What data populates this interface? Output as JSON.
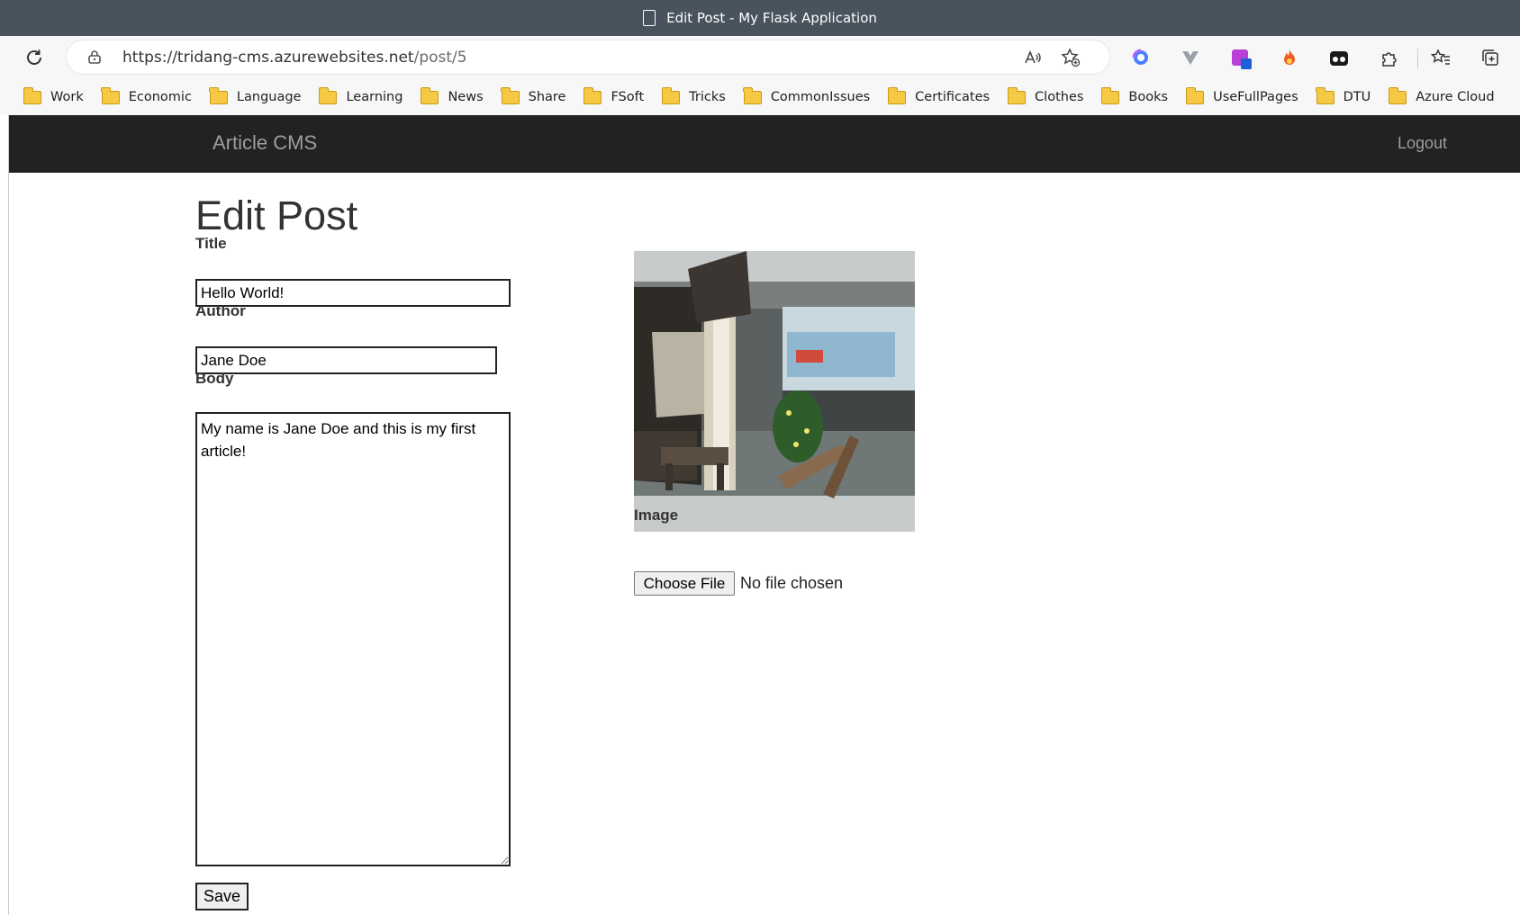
{
  "window": {
    "title": "Edit Post - My Flask Application"
  },
  "address_bar": {
    "url_host": "https://tridang-cms.azurewebsites.net",
    "url_path": "/post/5"
  },
  "bookmarks": [
    {
      "label": "Work"
    },
    {
      "label": "Economic"
    },
    {
      "label": "Language"
    },
    {
      "label": "Learning"
    },
    {
      "label": "News"
    },
    {
      "label": "Share"
    },
    {
      "label": "FSoft"
    },
    {
      "label": "Tricks"
    },
    {
      "label": "CommonIssues"
    },
    {
      "label": "Certificates"
    },
    {
      "label": "Clothes"
    },
    {
      "label": "Books"
    },
    {
      "label": "UseFullPages"
    },
    {
      "label": "DTU"
    },
    {
      "label": "Azure Cloud"
    }
  ],
  "navbar": {
    "brand": "Article CMS",
    "logout": "Logout"
  },
  "form": {
    "heading": "Edit Post",
    "title_label": "Title",
    "title_value": "Hello World!",
    "author_label": "Author",
    "author_value": "Jane Doe",
    "body_label": "Body",
    "body_value": "My name is Jane Doe and this is my first article!",
    "image_label": "Image",
    "choose_file": "Choose File",
    "file_status": "No file chosen",
    "save": "Save"
  },
  "icons": {
    "refresh": "refresh-icon",
    "lock": "lock-icon",
    "read_aloud": "read-aloud-icon",
    "add_favorite": "add-favorite-icon",
    "extensions": "puzzle-icon",
    "favorites": "favorites-icon",
    "collections": "collections-icon"
  },
  "colors": {
    "navbar_bg": "#222222",
    "titlebar_bg": "#48535e",
    "folder": "#f6c945"
  }
}
